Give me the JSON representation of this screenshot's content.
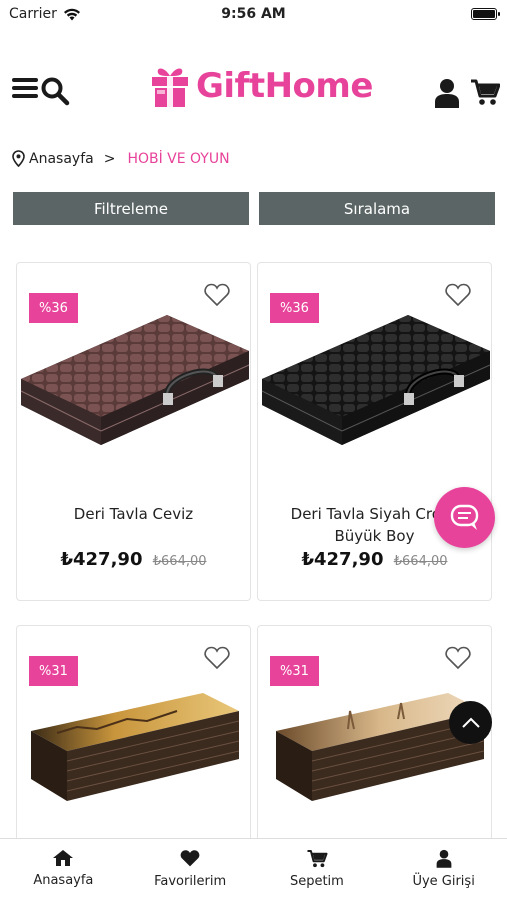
{
  "status_bar": {
    "carrier": "Carrier",
    "time": "9:56 AM"
  },
  "header": {
    "logo_text": "GiftHome"
  },
  "breadcrumb": {
    "home": "Anasayfa",
    "separator": ">",
    "current": "HOBİ VE OYUN"
  },
  "toolbar": {
    "filter_label": "Filtreleme",
    "sort_label": "Sıralama"
  },
  "products": [
    {
      "badge": "%36",
      "name": "Deri Tavla Ceviz",
      "price": "₺427,90",
      "old_price": "₺664,00"
    },
    {
      "badge": "%36",
      "name": "Deri Tavla Siyah Croco Büyük Boy",
      "price": "₺427,90",
      "old_price": "₺664,00"
    },
    {
      "badge": "%31"
    },
    {
      "badge": "%31"
    }
  ],
  "bottom_nav": [
    {
      "label": "Anasayfa",
      "icon": "home-icon"
    },
    {
      "label": "Favorilerim",
      "icon": "heart-icon"
    },
    {
      "label": "Sepetim",
      "icon": "cart-icon"
    },
    {
      "label": "Üye Girişi",
      "icon": "user-icon"
    }
  ],
  "colors": {
    "brand": "#e8439a",
    "toolbar": "#5b6566"
  }
}
